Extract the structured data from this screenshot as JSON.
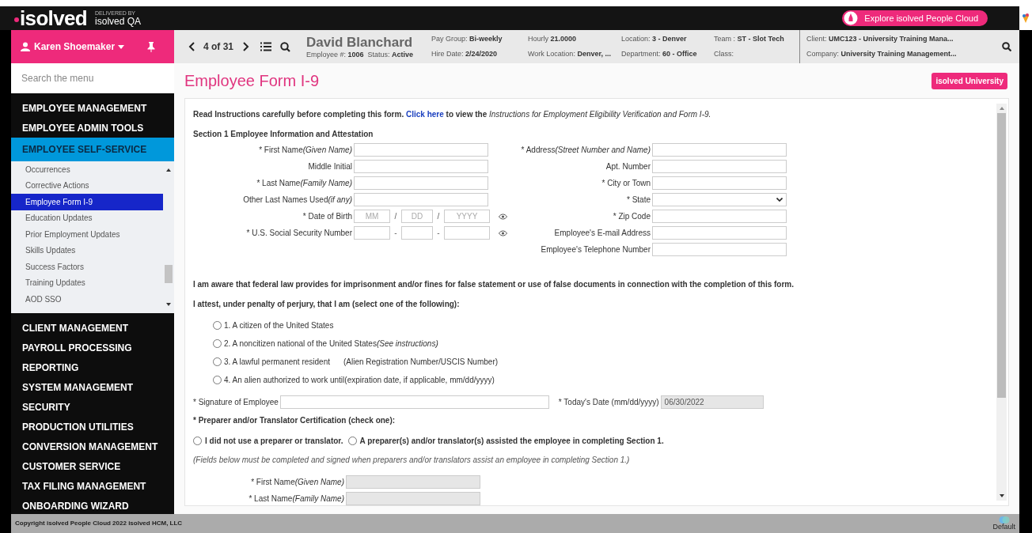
{
  "header": {
    "logo": "isolved",
    "delivered_by": "DELIVERED BY",
    "tenant": "isolved QA",
    "explore_button": "Explore isolved People Cloud"
  },
  "user": {
    "name": "Karen Shoemaker"
  },
  "record_nav": {
    "position": "4 of 31"
  },
  "employee": {
    "name": "David Blanchard",
    "details": [
      {
        "label": "Employee #:",
        "value": "1006"
      },
      {
        "label": "Status:",
        "value": "Active"
      }
    ],
    "info_columns": [
      [
        {
          "label": "Pay Group:",
          "value": "Bi-weekly"
        },
        {
          "label": "Hire Date:",
          "value": "2/24/2020"
        }
      ],
      [
        {
          "label": "Hourly",
          "value": "21.0000"
        },
        {
          "label": "Work Location:",
          "value": "Denver, ..."
        }
      ],
      [
        {
          "label": "Location:",
          "value": "3 - Denver"
        },
        {
          "label": "Department:",
          "value": "60 - Office"
        }
      ],
      [
        {
          "label": "Team :",
          "value": "ST - Slot Tech"
        },
        {
          "label": "Class:"
        }
      ]
    ],
    "client": [
      {
        "label": "Client:",
        "value": "UMC123 - University Training Mana..."
      },
      {
        "label": "Company:",
        "value": "University Training Management..."
      }
    ]
  },
  "sidebar": {
    "search": {
      "placeholder": "Search the menu"
    },
    "menu": [
      {
        "label": "EMPLOYEE MANAGEMENT",
        "expanded": false
      },
      {
        "label": "EMPLOYEE ADMIN TOOLS",
        "expanded": false
      },
      {
        "label": "EMPLOYEE SELF-SERVICE",
        "expanded": true,
        "children": [
          {
            "label": "Occurrences",
            "selected": false
          },
          {
            "label": "Corrective Actions",
            "selected": false
          },
          {
            "label": "Employee Form I-9",
            "selected": true
          },
          {
            "label": "Education Updates",
            "selected": false
          },
          {
            "label": "Prior Employment Updates",
            "selected": false
          },
          {
            "label": "Skills Updates",
            "selected": false
          },
          {
            "label": "Success Factors",
            "selected": false
          },
          {
            "label": "Training Updates",
            "selected": false
          },
          {
            "label": "AOD SSO",
            "selected": false
          }
        ]
      },
      {
        "label": "CLIENT MANAGEMENT",
        "expanded": false
      },
      {
        "label": "PAYROLL PROCESSING",
        "expanded": false
      },
      {
        "label": "REPORTING",
        "expanded": false
      },
      {
        "label": "SYSTEM MANAGEMENT",
        "expanded": false
      },
      {
        "label": "SECURITY",
        "expanded": false
      },
      {
        "label": "PRODUCTION UTILITIES",
        "expanded": false
      },
      {
        "label": "CONVERSION MANAGEMENT",
        "expanded": false
      },
      {
        "label": "CUSTOMER SERVICE",
        "expanded": false
      },
      {
        "label": "TAX FILING MANAGEMENT",
        "expanded": false
      },
      {
        "label": "ONBOARDING WIZARD",
        "expanded": false
      }
    ]
  },
  "page": {
    "title": "Employee Form I-9",
    "badge": "isolved University"
  },
  "form": {
    "intro": [
      {
        "kind": "bold",
        "text": "Read Instructions carefully before completing this form."
      },
      {
        "kind": "link",
        "text": "Click here"
      },
      {
        "kind": "bold",
        "text": "to view the"
      },
      {
        "kind": "italic",
        "text": "Instructions for Employment Eligibility Verification and Form I-9."
      }
    ],
    "section_title": "Section 1 Employee Information and Attestation",
    "left_fields": [
      {
        "kind": "text",
        "mark": "*",
        "label": "First Name",
        "hint": "(Given Name)"
      },
      {
        "kind": "text",
        "label": "Middle Initial"
      },
      {
        "kind": "text",
        "mark": "*",
        "label": "Last Name",
        "hint": "(Family Name)"
      },
      {
        "kind": "text",
        "label": "Other Last Names Used",
        "hint": "(if any)"
      },
      {
        "kind": "split",
        "mark": "*",
        "label": "Date of Birth",
        "placeholders": [
          "MM",
          "DD",
          "YYYY"
        ],
        "separators": [
          "/",
          "/"
        ]
      },
      {
        "kind": "split",
        "mark": "*",
        "label": "U.S. Social Security Number",
        "separators": [
          "-",
          "-"
        ]
      }
    ],
    "right_fields": [
      {
        "kind": "text",
        "mark": "*",
        "label": "Address",
        "hint": "(Street Number and Name)"
      },
      {
        "kind": "text",
        "label": "Apt. Number"
      },
      {
        "kind": "text",
        "mark": "*",
        "label": "City or Town"
      },
      {
        "kind": "select",
        "mark": "*",
        "label": "State"
      },
      {
        "kind": "text",
        "mark": "*",
        "label": "Zip Code"
      },
      {
        "kind": "text",
        "label": "Employee's E-mail Address"
      },
      {
        "kind": "text",
        "label": "Employee's Telephone Number"
      }
    ],
    "awareness": "I am aware that federal law provides for imprisonment and/or fines for false statement or use of false documents in connection with the completion of this form.",
    "attest": "I attest, under penalty of perjury, that I am (select one of the following):",
    "attest_options": [
      {
        "label": "1. A citizen of the United States",
        "selected": false
      },
      {
        "label": "2. A noncitizen national of the United States",
        "hint": "(See instructions)",
        "selected": false
      },
      {
        "label": "3. A lawful permanent resident",
        "note": "(Alien Registration Number/USCIS Number)",
        "selected": false
      },
      {
        "label": "4. An alien authorized to work until(expiration date, if applicable, mm/dd/yyyy)",
        "selected": false
      }
    ],
    "signature": {
      "mark": "*",
      "label": "Signature of Employee",
      "disabled": false
    },
    "todays_date": {
      "mark": "*",
      "label": "Today's Date (mm/dd/yyyy)",
      "value": "06/30/2022",
      "disabled": true
    },
    "preparer": {
      "mark": "*",
      "heading": "Preparer and/or Translator Certification (check one):",
      "options": [
        {
          "label": "I did not use a preparer or translator.",
          "selected": false
        },
        {
          "label": "A preparer(s) and/or translator(s) assisted the employee in completing Section 1.",
          "selected": false
        }
      ],
      "note": "(Fields below must be completed and signed when preparers and/or translators assist an employee in completing Section 1.)",
      "fields": [
        {
          "mark": "*",
          "label": "First Name",
          "hint": "(Given Name)",
          "disabled": true
        },
        {
          "mark": "*",
          "label": "Last Name",
          "hint": "(Family Name)",
          "disabled": true
        }
      ]
    }
  },
  "footer": {
    "copyright": "Copyright isolved People Cloud 2022 isolved HCM, LLC",
    "theme": "Default"
  }
}
